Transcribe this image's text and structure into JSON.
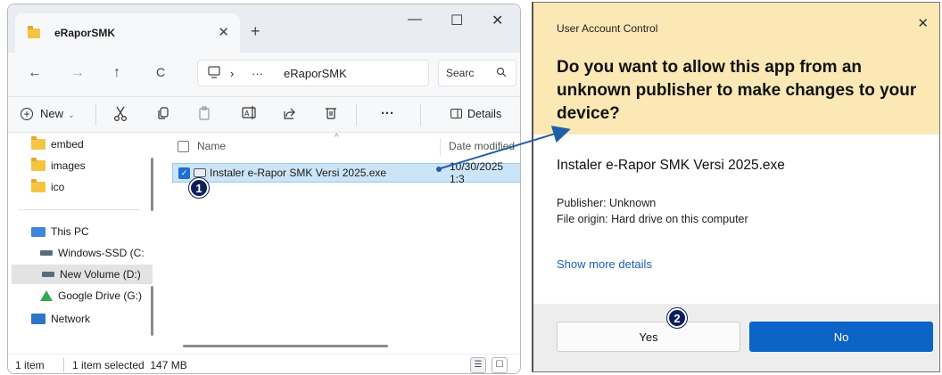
{
  "explorer": {
    "tab_title": "eRaporSMK",
    "new_tab_glyph": "+",
    "tab_close_glyph": "✕",
    "window_controls": {
      "minimize": "—",
      "maximize": "☐",
      "close": "✕"
    },
    "nav": {
      "back": "←",
      "forward": "→",
      "up": "↑",
      "refresh": "C"
    },
    "breadcrumb": {
      "chevron": "›",
      "ellipsis": "···",
      "current": "eRaporSMK"
    },
    "search": {
      "value": "Searc"
    },
    "toolbar": {
      "new_label": "New",
      "more_glyph": "···",
      "details_label": "Details",
      "icons": [
        "cut-icon",
        "copy-icon",
        "paste-icon",
        "rename-icon",
        "share-icon",
        "delete-icon"
      ]
    },
    "nav_pane": {
      "items": [
        {
          "label": "embed",
          "icon": "folder-icon"
        },
        {
          "label": "images",
          "icon": "folder-icon"
        },
        {
          "label": "ico",
          "icon": "folder-icon"
        },
        {
          "label": "This PC",
          "icon": "pc-icon"
        },
        {
          "label": "Windows-SSD (C:",
          "icon": "drive-icon"
        },
        {
          "label": "New Volume (D:)",
          "icon": "drive-icon",
          "selected": true
        },
        {
          "label": "Google Drive (G:)",
          "icon": "google-drive-icon"
        },
        {
          "label": "Network",
          "icon": "network-icon"
        }
      ]
    },
    "file_list": {
      "col_name": "Name",
      "col_date": "Date modified",
      "sort_glyph": "^",
      "file": {
        "name": "Instaler e-Rapor SMK Versi 2025.exe",
        "date": "10/30/2025 1:3"
      }
    },
    "status": {
      "items": "1 item",
      "selected": "1 item selected  147 MB"
    }
  },
  "uac": {
    "title": "User Account Control",
    "question": "Do you want to allow this app from an unknown publisher to make changes to your device?",
    "file_name": "Instaler e-Rapor SMK Versi 2025.exe",
    "publisher": "Publisher: Unknown",
    "origin": "File origin: Hard drive on this computer",
    "more_details": "Show more details",
    "yes_label": "Yes",
    "no_label": "No",
    "close_glyph": "✕"
  },
  "annotations": {
    "step1": "1",
    "step2": "2",
    "arrow_color": "#1f5fa8",
    "badge_color": "#0e1e5b"
  },
  "colors": {
    "uac_header": "#fbe8b5",
    "no_button": "#0b63c6",
    "selection": "#cce4f7",
    "link": "#1a5fb4"
  }
}
